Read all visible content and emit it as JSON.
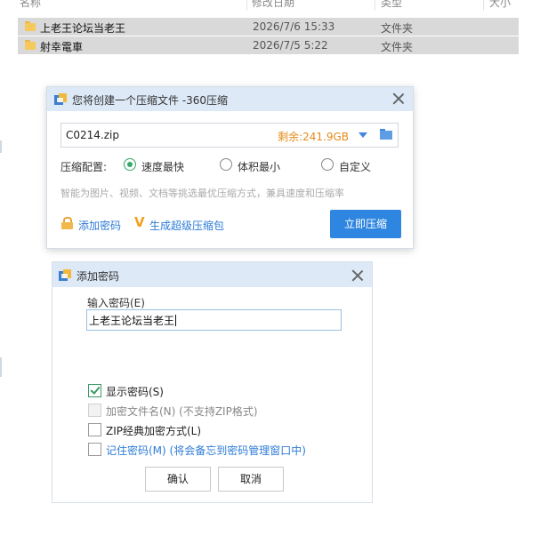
{
  "explorer": {
    "columns": [
      "名称",
      "修改日期",
      "类型",
      "大小"
    ],
    "rows": [
      {
        "name": "上老王论坛当老王",
        "date": "2026/7/6 15:33",
        "type": "文件夹"
      },
      {
        "name": "射幸電車",
        "date": "2026/7/5 5:22",
        "type": "文件夹"
      }
    ]
  },
  "compress_dialog": {
    "title": "您将创建一个压缩文件 -360压缩",
    "filename": "C0214.zip",
    "free_space": "剩余:241.9GB",
    "config_label": "压缩配置:",
    "options": [
      "速度最快",
      "体积最小",
      "自定义"
    ],
    "selected_option": "速度最快",
    "hint": "智能为图片、视频、文档等挑选最优压缩方式，兼具速度和压缩率",
    "add_password_link": "添加密码",
    "super_package_link": "生成超级压缩包",
    "compress_button": "立即压缩",
    "colors": {
      "accent": "#2f86e0",
      "free_space": "#e38a1a",
      "selected": "#36a86a"
    }
  },
  "password_dialog": {
    "title": "添加密码",
    "input_label": "输入密码(E)",
    "password_value": "上老王论坛当老王",
    "checkboxes": [
      {
        "label": "显示密码(S)",
        "checked": true,
        "disabled": false
      },
      {
        "label": "加密文件名(N) (不支持ZIP格式)",
        "checked": false,
        "disabled": true
      },
      {
        "label": "ZIP经典加密方式(L)",
        "checked": false,
        "disabled": false
      },
      {
        "label": "记住密码(M) (将会备忘到密码管理窗口中)",
        "checked": false,
        "disabled": false
      }
    ],
    "ok_button": "确认",
    "cancel_button": "取消"
  }
}
